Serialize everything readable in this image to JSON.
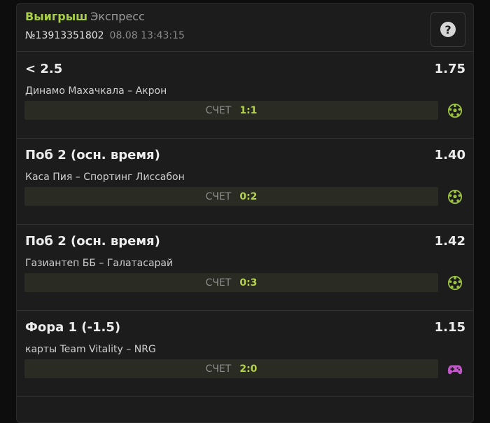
{
  "header": {
    "status": "Выигрыш",
    "type": "Экспресс",
    "bet_id": "№13913351802",
    "date": "08.08 13:43:15",
    "help_glyph": "?"
  },
  "colors": {
    "accent": "#a8cf45",
    "gamepad": "#c057c9",
    "background": "#1c1c1d"
  },
  "score_label": "СЧЕТ",
  "bets": [
    {
      "outcome": "< 2.5",
      "odds": "1.75",
      "match": "Динамо Махачкала – Акрон",
      "score": "1:1",
      "icon": "soccer-ball-icon"
    },
    {
      "outcome": "Поб 2 (осн. время)",
      "odds": "1.40",
      "match": "Каса Пия – Спортинг Лиссабон",
      "score": "0:2",
      "icon": "soccer-ball-icon"
    },
    {
      "outcome": "Поб 2 (осн. время)",
      "odds": "1.42",
      "match": "Газиантеп ББ – Галатасарай",
      "score": "0:3",
      "icon": "soccer-ball-icon"
    },
    {
      "outcome": "Фора 1 (-1.5)",
      "odds": "1.15",
      "match": "карты Team Vitality – NRG",
      "score": "2:0",
      "icon": "gamepad-icon"
    }
  ]
}
